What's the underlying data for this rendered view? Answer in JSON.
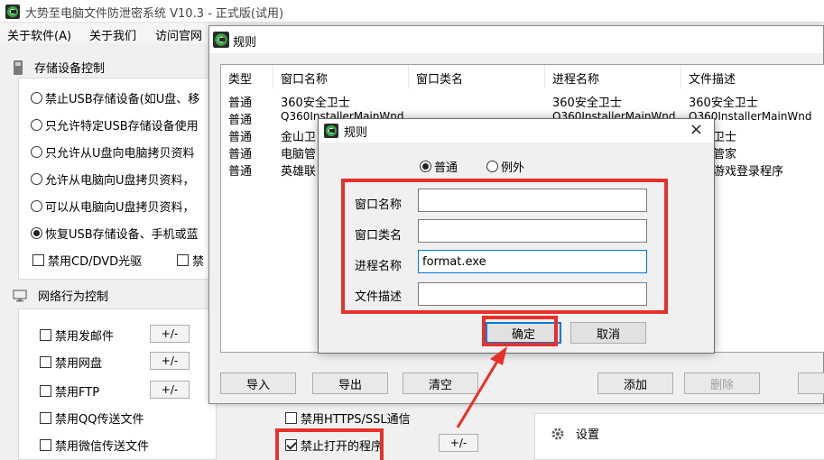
{
  "main_window": {
    "title": "大势至电脑文件防泄密系统 V10.3 - 正式版(试用)",
    "menu": [
      "关于软件(A)",
      "关于我们",
      "访问官网"
    ],
    "storage": {
      "header": "存储设备控制",
      "radios": [
        {
          "label": "禁止USB存储设备(如U盘、移",
          "checked": false
        },
        {
          "label": "只允许特定USB存储设备使用",
          "checked": false
        },
        {
          "label": "只允许从U盘向电脑拷贝资料",
          "checked": false
        },
        {
          "label": "允许从电脑向U盘拷贝资料，",
          "checked": false
        },
        {
          "label": "可以从电脑向U盘拷贝资料，",
          "checked": false
        },
        {
          "label": "恢复USB存储设备、手机或蓝",
          "checked": true
        }
      ],
      "checkboxes": [
        {
          "label": "禁用CD/DVD光驱",
          "checked": false
        },
        {
          "label": "禁",
          "checked": false
        }
      ]
    },
    "network": {
      "header": "网络行为控制",
      "items": [
        {
          "label": "禁用发邮件",
          "checked": false,
          "button": "+/-"
        },
        {
          "label": "禁用网盘",
          "checked": false,
          "button": "+/-"
        },
        {
          "label": "禁用FTP",
          "checked": false,
          "button": "+/-"
        },
        {
          "label": "禁用QQ传送文件",
          "checked": false
        },
        {
          "label": "禁用微信传送文件",
          "checked": false
        }
      ],
      "extra": [
        {
          "label": "禁用HTTPS/SSL通信",
          "checked": false
        },
        {
          "label": "禁止打开的程序",
          "checked": true,
          "button": "+/-"
        }
      ]
    },
    "settings_label": "设置"
  },
  "rule_window": {
    "title": "规则",
    "columns": [
      "类型",
      "窗口名称",
      "窗口类名",
      "进程名称",
      "文件描述"
    ],
    "rows": [
      [
        "普通",
        "360安全卫士",
        "",
        "360安全卫士",
        "360安全卫士"
      ],
      [
        "普通",
        "Q360InstallerMainWnd",
        "",
        "Q360InstallerMainWnd",
        "Q360InstallerMainWnd"
      ],
      [
        "普通",
        "金山卫",
        "",
        "",
        "卫士"
      ],
      [
        "普通",
        "电脑管",
        "",
        "",
        "管家"
      ],
      [
        "普通",
        "英雄联",
        "",
        "",
        "游戏登录程序"
      ]
    ],
    "buttons": {
      "import": "导入",
      "export": "导出",
      "clear": "清空",
      "add": "添加",
      "delete": "删除"
    }
  },
  "edit_dialog": {
    "title": "规则",
    "close": "×",
    "type_options": [
      {
        "label": "普通",
        "checked": true
      },
      {
        "label": "例外",
        "checked": false
      }
    ],
    "fields": [
      {
        "label": "窗口名称",
        "value": ""
      },
      {
        "label": "窗口类名",
        "value": ""
      },
      {
        "label": "进程名称",
        "value": "format.exe"
      },
      {
        "label": "文件描述",
        "value": ""
      }
    ],
    "ok": "确定",
    "cancel": "取消"
  },
  "colors": {
    "annotation": "#e8302a",
    "focus": "#0078d7"
  }
}
